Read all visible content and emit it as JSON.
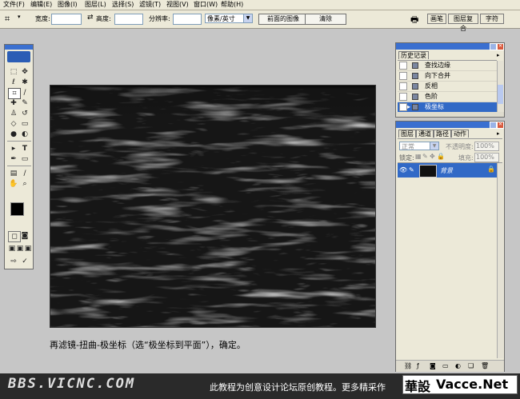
{
  "menubar": {
    "items": [
      "文件(F)",
      "编辑(E)",
      "图像(I)",
      "图层(L)",
      "选择(S)",
      "滤镜(T)",
      "视图(V)",
      "窗口(W)",
      "帮助(H)"
    ]
  },
  "options": {
    "width_label": "宽度:",
    "height_label": "高度:",
    "resolution_label": "分辨率:",
    "unit_value": "像素/英寸",
    "front_image_label": "前面的图像",
    "clear_label": "清除"
  },
  "wells": {
    "tab_brushes": "画笔",
    "tab_comps": "图层复合",
    "tab_char": "字符"
  },
  "history": {
    "tab": "历史记录",
    "items": [
      "查找边缘",
      "向下合并",
      "反相",
      "色阶",
      "极坐标"
    ],
    "selected_index": 4
  },
  "layers": {
    "tabs": [
      "图层",
      "通道",
      "路径",
      "动作"
    ],
    "blend_mode": "正常",
    "opacity_label": "不透明度:",
    "opacity_value": "100%",
    "lock_label": "锁定:",
    "fill_label": "填充:",
    "fill_value": "100%",
    "layer_name": "背景"
  },
  "caption": "再滤镜-扭曲-极坐标（选“极坐标到平面”），确定。",
  "banner": {
    "site": "BBS.VICNC.COM",
    "text": "此教程为创意设计论坛原创教程。更多精采作",
    "logo_a": "華設",
    "logo_b": "Vacce.Net"
  },
  "colors": {
    "accent": "#3a6fd0",
    "selection": "#3169c6",
    "canvas_bg": "#1a1a1a",
    "foreground": "#000000",
    "background": "#ffffff"
  }
}
